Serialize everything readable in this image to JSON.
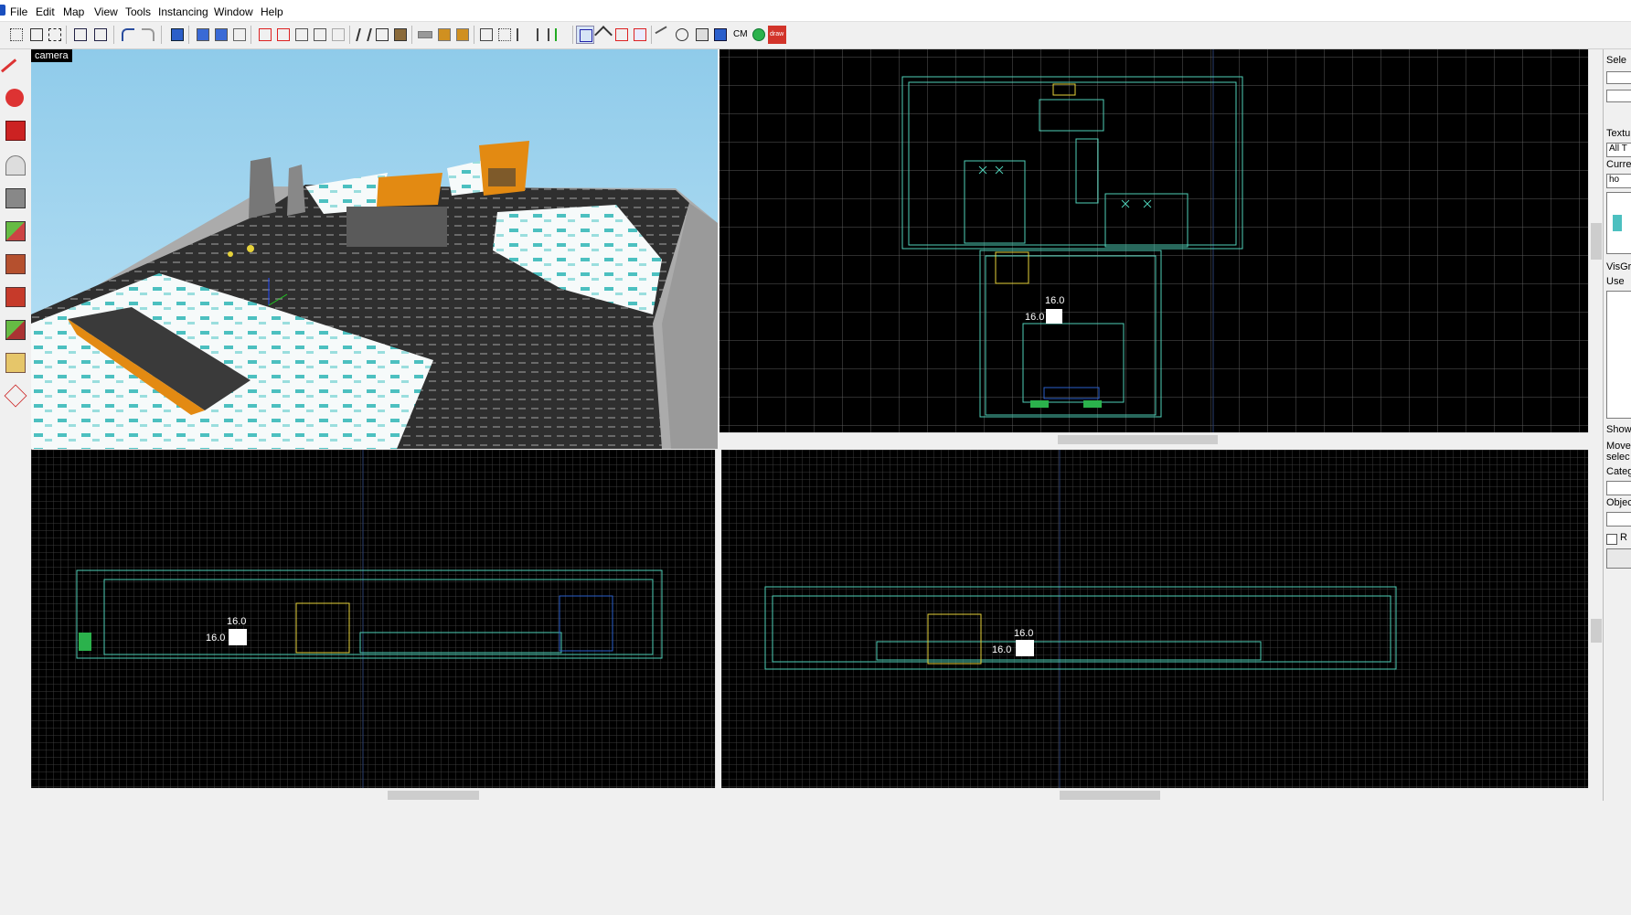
{
  "menu": {
    "items": [
      "File",
      "Edit",
      "Map",
      "View",
      "Tools",
      "Instancing",
      "Window",
      "Help"
    ]
  },
  "toolbar": {
    "cm_label": "CM",
    "draw_label": "draw"
  },
  "viewports": {
    "camera_label": "camera",
    "top": {
      "grid_w": "16.0",
      "grid_h": "16.0"
    },
    "front": {
      "grid_w": "16.0",
      "grid_h": "16.0"
    },
    "side": {
      "grid_w": "16.0",
      "grid_h": "16.0"
    }
  },
  "right_panel": {
    "select_label": "Sele",
    "texture_label": "Textu",
    "texture_filter": "All T",
    "current_label": "Curren",
    "current_texture": "ho",
    "visgroup_label": "VisGr",
    "visgroup_tab": "Use",
    "show_label": "Show",
    "move_label": "Move",
    "move_label_2": "selec",
    "category_label": "Categ",
    "objects_label": "Objec",
    "random_label": "R"
  },
  "colors": {
    "sky": "#a6d7f1",
    "viewport_bg": "#000000",
    "brush_outline": "#4fd0b8",
    "selection_yellow": "#e6d23a",
    "accent_orange": "#e38a12"
  }
}
